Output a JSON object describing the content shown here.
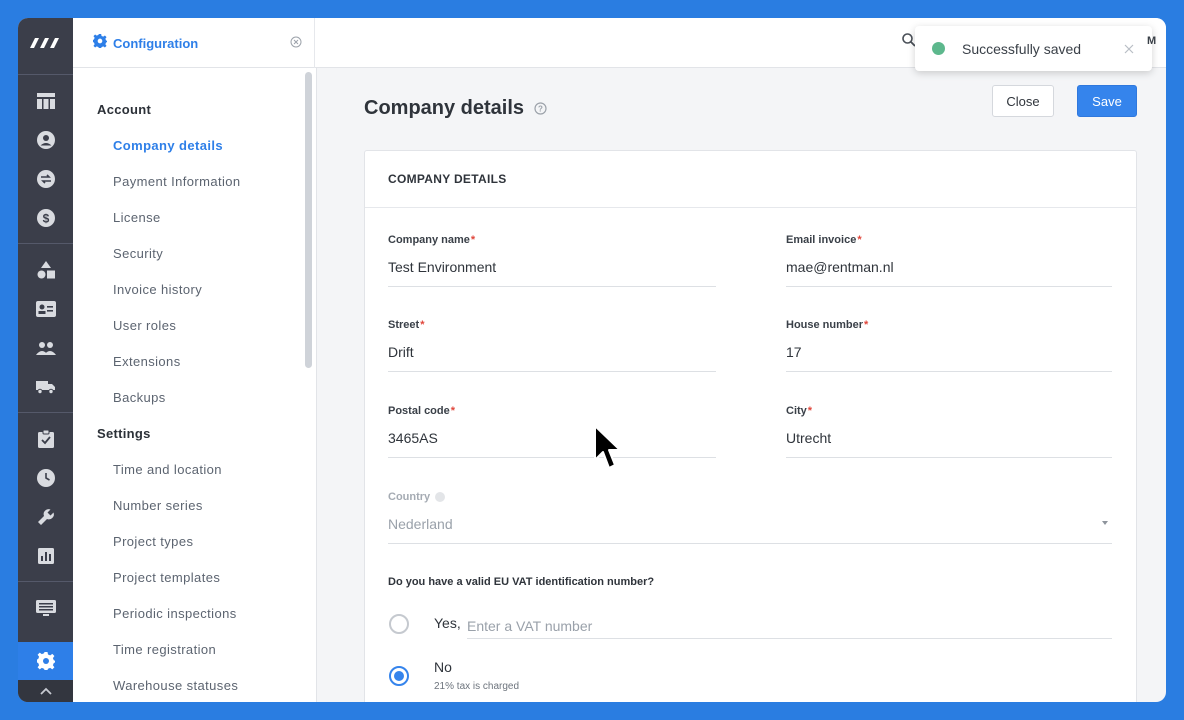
{
  "tab": {
    "title": "Configuration"
  },
  "toast": {
    "message": "Successfully saved"
  },
  "header": {
    "edge_text": "M"
  },
  "nav": {
    "groups": [
      {
        "title": "Account",
        "items": [
          "Company details",
          "Payment Information",
          "License",
          "Security",
          "Invoice history",
          "User roles",
          "Extensions",
          "Backups"
        ]
      },
      {
        "title": "Settings",
        "items": [
          "Time and location",
          "Number series",
          "Project types",
          "Project templates",
          "Periodic inspections",
          "Time registration",
          "Warehouse statuses"
        ]
      }
    ],
    "active_item": "Company details"
  },
  "page": {
    "title": "Company details",
    "close_label": "Close",
    "save_label": "Save"
  },
  "card": {
    "heading": "COMPANY DETAILS",
    "fields": {
      "company_name": {
        "label": "Company name",
        "required": "*",
        "value": "Test Environment"
      },
      "email_invoice": {
        "label": "Email invoice",
        "required": "*",
        "value": "mae@rentman.nl"
      },
      "street": {
        "label": "Street",
        "required": "*",
        "value": "Drift"
      },
      "house_number": {
        "label": "House number",
        "required": "*",
        "value": "17"
      },
      "postal_code": {
        "label": "Postal code",
        "required": "*",
        "value": "3465AS"
      },
      "city": {
        "label": "City",
        "required": "*",
        "value": "Utrecht"
      },
      "country": {
        "label": "Country",
        "value": "Nederland"
      }
    },
    "vat": {
      "question": "Do you have a valid EU VAT identification number?",
      "yes_label": "Yes,",
      "vat_placeholder": "Enter a VAT number",
      "vat_value": "",
      "no_label": "No",
      "no_sub": "21% tax is charged",
      "selected": "no"
    }
  },
  "colors": {
    "accent": "#2e7fe8",
    "rail": "#3b3e4a",
    "success": "#5db88d",
    "frame": "#2a7de1"
  },
  "icons": [
    "logo-icon",
    "dashboard-icon",
    "user-icon",
    "swap-icon",
    "dollar-icon",
    "shapes-icon",
    "contact-card-icon",
    "people-icon",
    "truck-icon",
    "clipboard-icon",
    "clock-icon",
    "wrench-icon",
    "chart-icon",
    "list-icon",
    "gear-icon",
    "chevron-up-icon",
    "search-icon",
    "close-icon",
    "help-icon"
  ]
}
